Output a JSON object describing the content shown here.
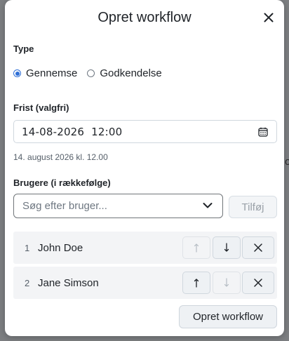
{
  "dialog": {
    "title": "Opret workflow"
  },
  "type_section": {
    "label": "Type",
    "options": [
      {
        "label": "Gennemse",
        "selected": true
      },
      {
        "label": "Godkendelse",
        "selected": false
      }
    ]
  },
  "deadline": {
    "label": "Frist (valgfri)",
    "value": "14-08-2026  12:00",
    "hint": "14. august 2026 kl. 12.00"
  },
  "users": {
    "label": "Brugere (i rækkefølge)",
    "search_placeholder": "Søg efter bruger...",
    "add_label": "Tilføj",
    "list": [
      {
        "num": "1",
        "name": "John Doe",
        "up_enabled": false,
        "down_enabled": true
      },
      {
        "num": "2",
        "name": "Jane Simson",
        "up_enabled": true,
        "down_enabled": false
      }
    ]
  },
  "submit_label": "Opret workflow",
  "colors": {
    "accent": "#2f6fd6",
    "backdrop": "#7d7f82",
    "row_bg": "#f3f4f6"
  },
  "icons": {
    "close": "close-icon",
    "calendar": "calendar-icon",
    "chevron": "chevron-down-icon",
    "up": "arrow-up-icon",
    "down": "arrow-down-icon",
    "remove": "remove-icon"
  }
}
